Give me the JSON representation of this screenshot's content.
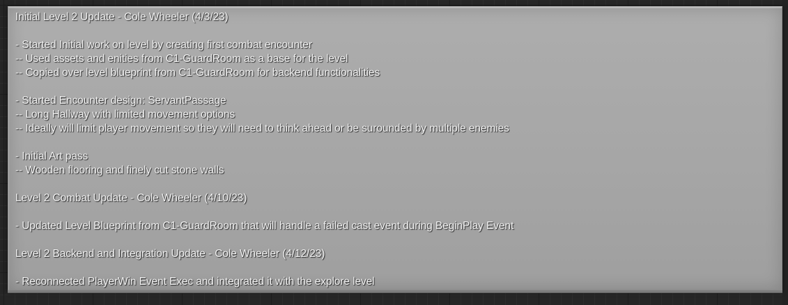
{
  "comment": {
    "lines": [
      "Initial Level 2 Update - Cole Wheeler (4/3/23)",
      "",
      "- Started Initial work on level by creating first combat encounter",
      "-- Used assets and enities from C1-GuardRoom as a base for the level",
      "-- Copied over level blueprint from C1-GuardRoom for backend functionalities",
      "",
      "- Started Encounter design: ServantPassage",
      "-- Long Hallway with limited movement options",
      "-- Ideally will limit player movement so they will need to think ahead or be surounded by multiple enemies",
      "",
      "- Initial Art pass",
      "-- Wooden flooring and finely cut stone walls",
      "",
      "Level 2 Combat Update - Cole Wheeler (4/10/23)",
      "",
      "- Updated Level Blueprint from C1-GuardRoom that will handle a failed cast event during BeginPlay Event",
      "",
      "Level 2 Backend and Integration Update - Cole Wheeler (4/12/23)",
      "",
      "- Reconnected PlayerWin Event Exec and integrated it with the explore level"
    ]
  },
  "colors": {
    "canvas_background": "#262626",
    "comment_background": "#a9a9a9",
    "comment_text": "#f4f4f4"
  }
}
